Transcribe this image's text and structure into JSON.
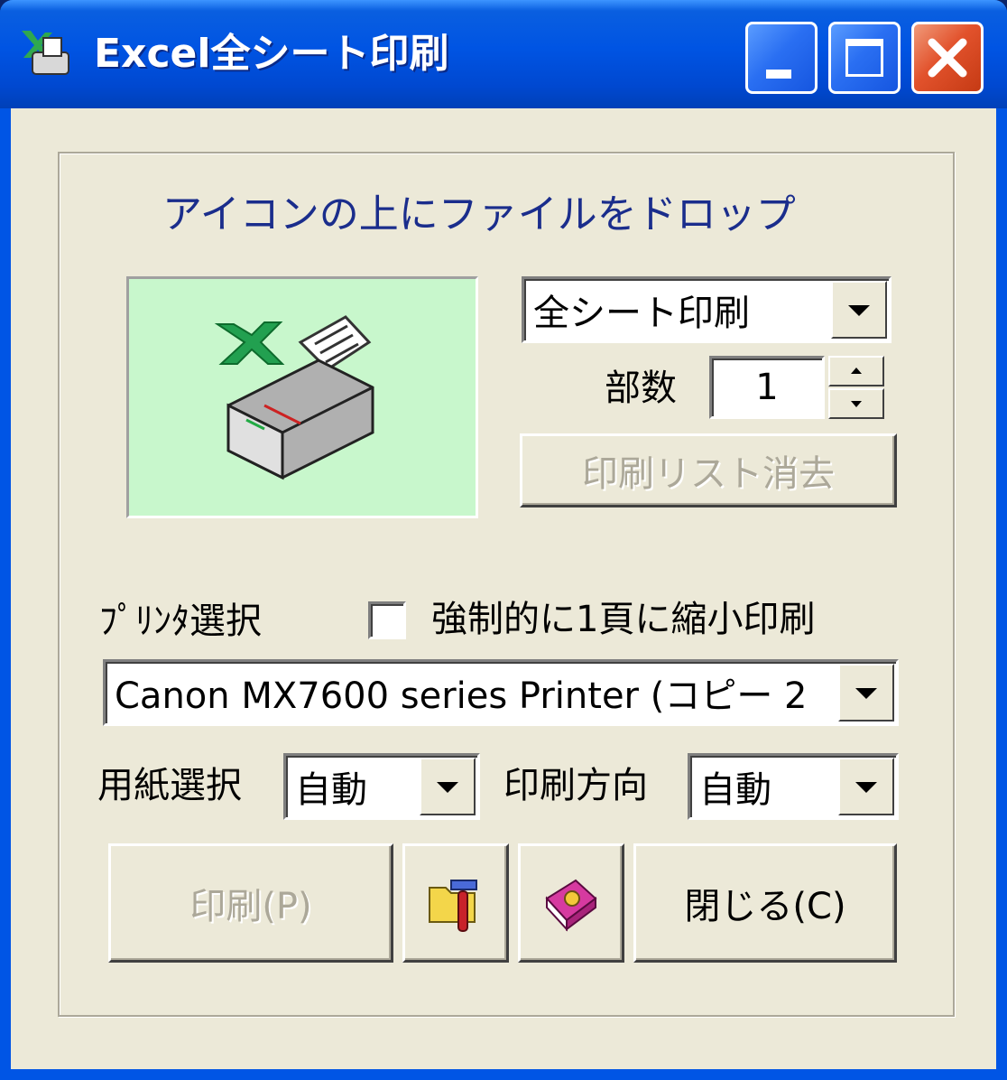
{
  "window": {
    "title": "Excel全シート印刷",
    "controls": {
      "minimize": "minimize",
      "maximize": "maximize",
      "close": "close"
    }
  },
  "drop_hint": "アイコンの上にファイルをドロップ",
  "print_mode": {
    "selected": "全シート印刷"
  },
  "copies": {
    "label": "部数",
    "value": "1"
  },
  "clear_list_button": "印刷リスト消去",
  "printer": {
    "label": "ﾌﾟﾘﾝﾀ選択",
    "selected": "Canon MX7600 series Printer (コピー 2"
  },
  "shrink_option": {
    "label": "強制的に1頁に縮小印刷",
    "checked": false
  },
  "paper": {
    "label": "用紙選択",
    "selected": "自動"
  },
  "orientation": {
    "label": "印刷方向",
    "selected": "自動"
  },
  "buttons": {
    "print": "印刷(P)",
    "close": "閉じる(C)"
  },
  "icons": {
    "app": "excel-printer-icon",
    "drop_image": "excel-printer-icon",
    "settings": "folder-tools-icon",
    "help": "help-book-icon"
  }
}
